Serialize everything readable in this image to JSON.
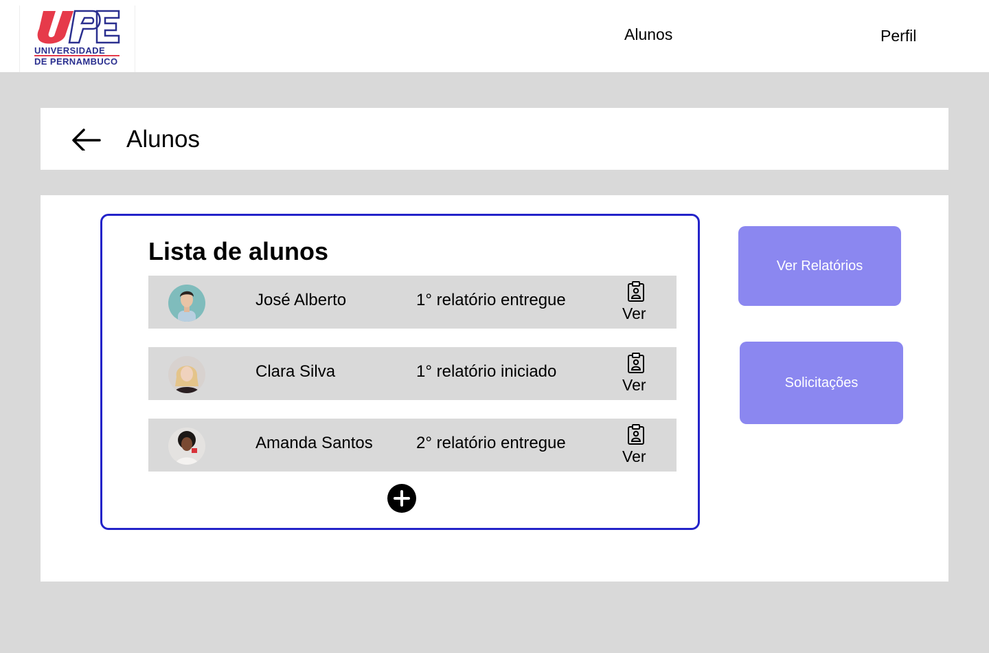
{
  "logo": {
    "line1": "UNIVERSIDADE",
    "line2": "DE PERNAMBUCO",
    "colors": {
      "red": "#e63a4a",
      "blue": "#2a2f8f"
    }
  },
  "nav": {
    "items": [
      {
        "label": "Alunos"
      },
      {
        "label": "Perfil"
      }
    ]
  },
  "header": {
    "title": "Alunos",
    "back_icon": "arrow-left-icon"
  },
  "list": {
    "title": "Lista de alunos",
    "border_color": "#2323c9",
    "rows": [
      {
        "name": "José Alberto",
        "status": "1° relatório entregue",
        "action": "Ver",
        "icon": "clipboard-user-icon"
      },
      {
        "name": "Clara Silva",
        "status": "1° relatório iniciado",
        "action": "Ver",
        "icon": "clipboard-user-icon"
      },
      {
        "name": "Amanda Santos",
        "status": "2° relatório entregue",
        "action": "Ver",
        "icon": "clipboard-user-icon"
      }
    ],
    "add_icon": "plus-circle-icon"
  },
  "side": {
    "reports_label": "Ver Relatórios",
    "requests_label": "Solicitações",
    "button_color": "#8b87f0"
  }
}
